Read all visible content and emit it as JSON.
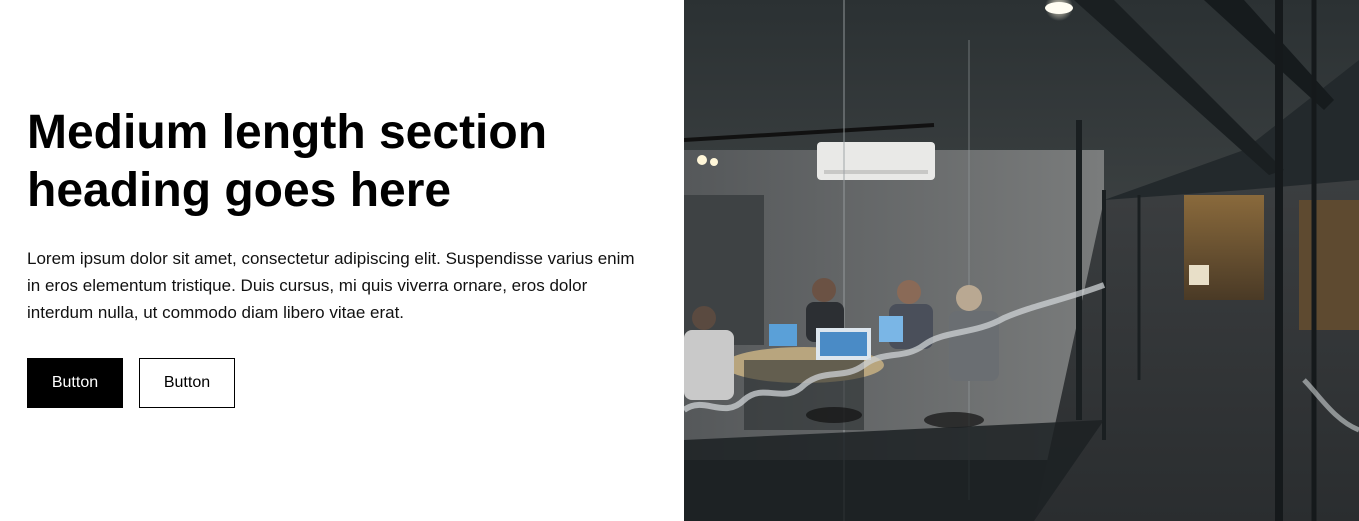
{
  "hero": {
    "heading": "Medium length section heading goes here",
    "body": "Lorem ipsum dolor sit amet, consectetur adipiscing elit. Suspendisse varius enim in eros elementum tristique. Duis cursus, mi quis viverra ornare, eros dolor interdum nulla, ut commodo diam libero vitae erat.",
    "primary_button_label": "Button",
    "secondary_button_label": "Button"
  },
  "colors": {
    "primary_button_bg": "#000000",
    "primary_button_text": "#ffffff",
    "secondary_button_border": "#000000",
    "page_bg": "#ffffff"
  }
}
